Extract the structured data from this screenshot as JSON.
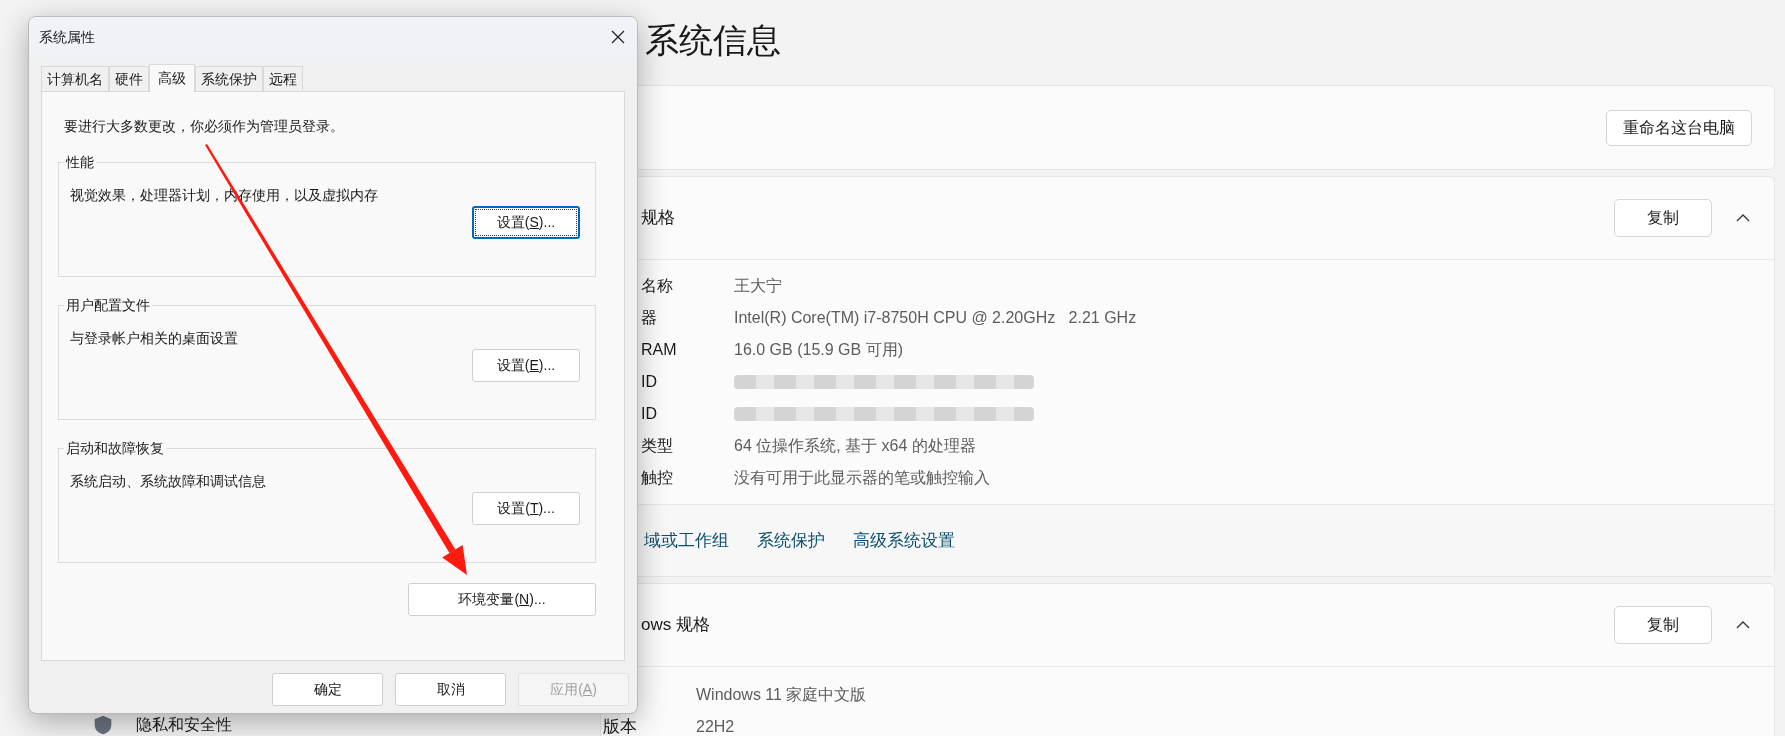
{
  "settings": {
    "title": "系统信息",
    "rename_button": "重命名这台电脑",
    "device_specs": {
      "heading": "规格",
      "copy_button": "复制",
      "expanded": true,
      "rows": [
        {
          "kind": "text",
          "label": "名称",
          "value": "王大宁"
        },
        {
          "kind": "text",
          "label": "器",
          "value": "Intel(R) Core(TM) i7-8750H CPU @ 2.20GHz   2.21 GHz"
        },
        {
          "kind": "text",
          "label": "RAM",
          "value": "16.0 GB (15.9 GB 可用)"
        },
        {
          "kind": "redacted",
          "label": "ID"
        },
        {
          "kind": "redacted",
          "label": "ID"
        },
        {
          "kind": "text",
          "label": "类型",
          "value": "64 位操作系统, 基于 x64 的处理器"
        },
        {
          "kind": "text",
          "label": "触控",
          "value": "没有可用于此显示器的笔或触控输入"
        }
      ],
      "links": [
        "域或工作组",
        "系统保护",
        "高级系统设置"
      ]
    },
    "windows_specs": {
      "heading": "ows 规格",
      "copy_button": "复制",
      "expanded": true,
      "rows": [
        {
          "kind": "text",
          "value": "Windows 11 家庭中文版"
        },
        {
          "kind": "text",
          "label": "版本",
          "value": "22H2"
        }
      ]
    }
  },
  "sidebar": {
    "items": [
      {
        "label": "隐私和安全性"
      }
    ]
  },
  "dialog": {
    "title": "系统属性",
    "tabs": [
      {
        "label": "计算机名",
        "selected": false
      },
      {
        "label": "硬件",
        "selected": false
      },
      {
        "label": "高级",
        "selected": true
      },
      {
        "label": "系统保护",
        "selected": false
      },
      {
        "label": "远程",
        "selected": false
      }
    ],
    "notice": "要进行大多数更改，你必须作为管理员登录。",
    "groups": [
      {
        "title": "性能",
        "description": "视觉效果，处理器计划，内存使用，以及虚拟内存",
        "button": {
          "prefix": "设置(",
          "key": "S",
          "suffix": ")...",
          "focused": true
        }
      },
      {
        "title": "用户配置文件",
        "description": "与登录帐户相关的桌面设置",
        "button": {
          "prefix": "设置(",
          "key": "E",
          "suffix": ")...",
          "focused": false
        }
      },
      {
        "title": "启动和故障恢复",
        "description": "系统启动、系统故障和调试信息",
        "button": {
          "prefix": "设置(",
          "key": "T",
          "suffix": ")...",
          "focused": false
        }
      }
    ],
    "env_button": {
      "prefix": "环境变量(",
      "key": "N",
      "suffix": ")...",
      "focused": false
    },
    "footer_buttons": [
      {
        "label": "确定",
        "disabled": false
      },
      {
        "label": "取消",
        "disabled": false
      },
      {
        "prefix": "应用(",
        "key": "A",
        "suffix": ")",
        "disabled": true
      }
    ]
  }
}
